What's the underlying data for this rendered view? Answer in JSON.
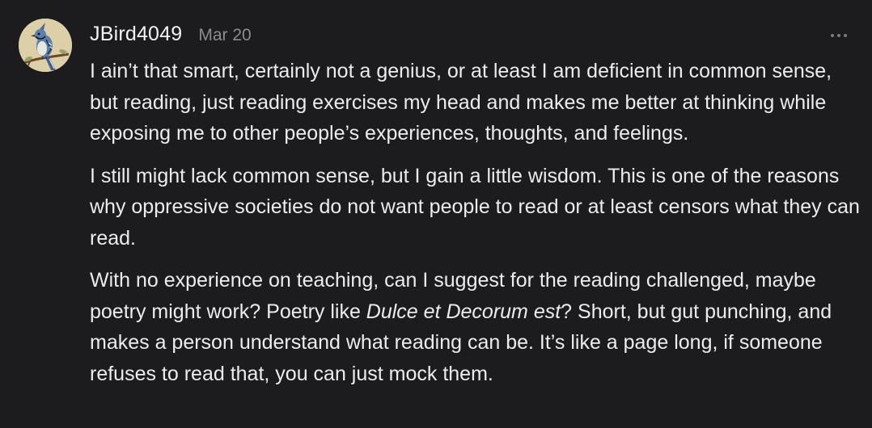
{
  "comment": {
    "author": "JBird4049",
    "date": "Mar 20",
    "avatar_icon": "blue-jay-bird-avatar",
    "more_icon": "ellipsis-icon",
    "paragraphs": [
      "I ain’t that smart, certainly not a genius, or at least I am deficient in common sense, but reading, just reading exercises my head and makes me better at thinking while exposing me to other people’s experiences, thoughts, and feelings.",
      "I still might lack common sense, but I gain a little wisdom. This is one of the reasons why oppressive societies do not want people to read or at least censors what they can read."
    ],
    "paragraph3": {
      "before": "With no experience on teaching, can I suggest for the reading challenged, maybe poetry might work? Poetry like ",
      "title": "Dulce et Decorum est",
      "after": "? Short, but gut punching, and makes a person understand what reading can be. It’s like a page long, if someone refuses to read that, you can just mock them."
    }
  },
  "colors": {
    "background": "#1c1c1e",
    "text": "#ececec",
    "muted": "#8c8c90"
  }
}
